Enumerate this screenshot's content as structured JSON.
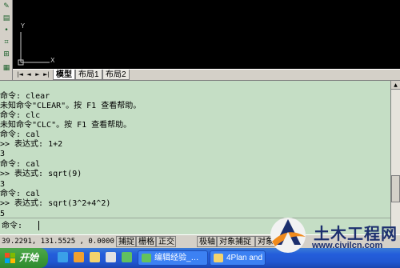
{
  "toolbar": {
    "icons": [
      "draw-icon",
      "hatch-icon",
      "dot-icon",
      "edit-icon",
      "array-icon",
      "table-icon"
    ]
  },
  "canvas": {
    "ucs_y": "Y",
    "ucs_x": "X"
  },
  "tabs": {
    "nav": [
      "|◄",
      "◄",
      "►",
      "►|"
    ],
    "items": [
      "模型",
      "布局1",
      "布局2"
    ],
    "active": "模型"
  },
  "command": {
    "history": [
      "命令: clear",
      "未知命令\"CLEAR\"。按 F1 查看帮助。",
      "命令: clc",
      "未知命令\"CLC\"。按 F1 查看帮助。",
      "命令: cal",
      ">> 表达式: 1+2",
      "3",
      "命令: cal",
      ">> 表达式: sqrt(9)",
      "3",
      "命令: cal",
      ">> 表达式: sqrt(3^2+4^2)",
      "5"
    ],
    "prompt": "命令:",
    "input_value": ""
  },
  "status": {
    "coords": "39.2291,  131.5525 , 0.0000",
    "buttons": [
      "捕捉",
      "栅格",
      "正交",
      "极轴",
      "对象捕捉",
      "对象追踪"
    ]
  },
  "taskbar": {
    "start": "开始",
    "quicklaunch": [
      "ie-icon",
      "media-icon",
      "folder-icon",
      "mail-icon",
      "qq-icon"
    ],
    "tasks": [
      {
        "label": "编辑经验_…",
        "icon": "browser-icon"
      },
      {
        "label": "4Plan and",
        "icon": "folder-icon"
      }
    ]
  },
  "watermark": {
    "title": "土木工程网",
    "url": "www.civilcn.com"
  },
  "colors": {
    "canvas": "#000000",
    "command_bg": "#c5dec5",
    "taskbar": "#245edb",
    "start": "#3c9a3a"
  }
}
